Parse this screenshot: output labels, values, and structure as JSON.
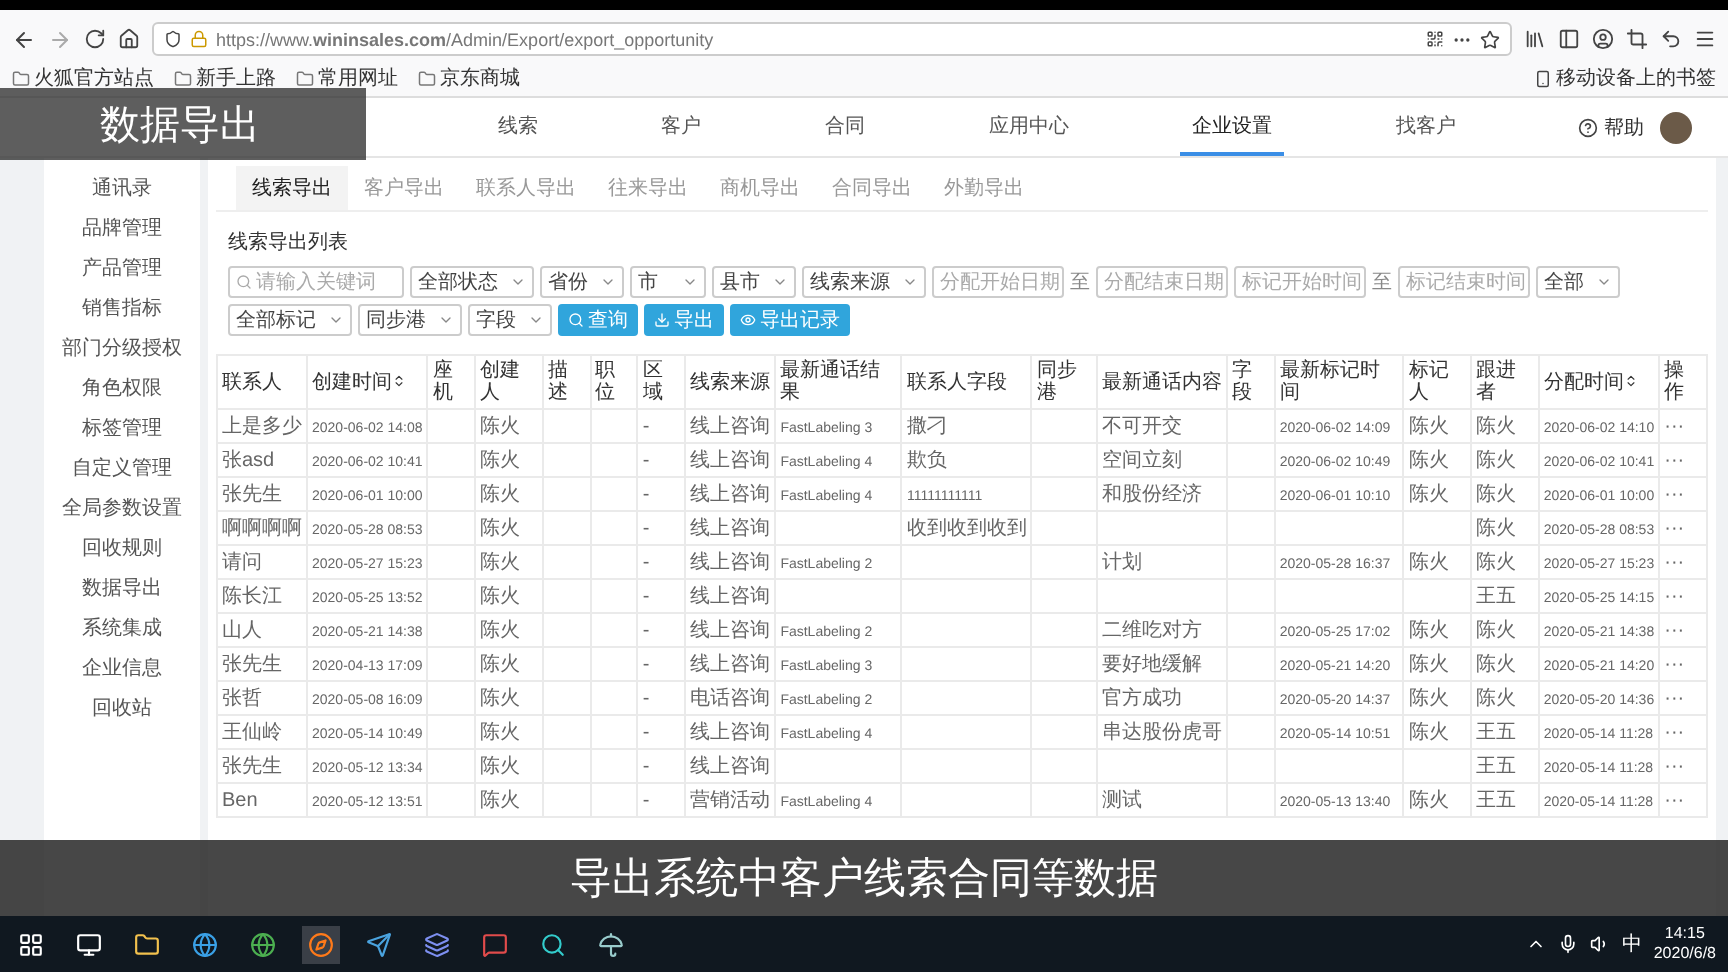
{
  "browser": {
    "url": "https://www.**wininsales.com**/Admin/Export/export_opportunity",
    "bookmarks": [
      "火狐官方站点",
      "新手上路",
      "常用网址",
      "京东商城"
    ],
    "mobile_bookmarks": "移动设备上的书签"
  },
  "caption": "数据导出",
  "nav": {
    "items": [
      {
        "label": "线索",
        "selected": false
      },
      {
        "label": "客户",
        "selected": false
      },
      {
        "label": "合同",
        "selected": false
      },
      {
        "label": "应用中心",
        "selected": false
      },
      {
        "label": "企业设置",
        "selected": true
      },
      {
        "label": "找客户",
        "selected": false
      }
    ],
    "help": "帮助"
  },
  "sidebar": {
    "items": [
      "通讯录",
      "品牌管理",
      "产品管理",
      "销售指标",
      "部门分级授权",
      "角色权限",
      "标签管理",
      "自定义管理",
      "全局参数设置",
      "回收规则",
      "数据导出",
      "系统集成",
      "企业信息",
      "回收站"
    ]
  },
  "tabs": [
    {
      "label": "线索导出",
      "selected": true
    },
    {
      "label": "客户导出",
      "selected": false
    },
    {
      "label": "联系人导出",
      "selected": false
    },
    {
      "label": "往来导出",
      "selected": false
    },
    {
      "label": "商机导出",
      "selected": false
    },
    {
      "label": "合同导出",
      "selected": false
    },
    {
      "label": "外勤导出",
      "selected": false
    }
  ],
  "list_title": "线索导出列表",
  "filters": [
    {
      "kind": "search",
      "placeholder": "请输入关键词"
    },
    {
      "kind": "select",
      "value": "全部状态"
    },
    {
      "kind": "select",
      "value": "省份"
    },
    {
      "kind": "select",
      "value": "市"
    },
    {
      "kind": "select",
      "value": "县市"
    },
    {
      "kind": "select",
      "value": "线索来源"
    },
    {
      "kind": "date",
      "placeholder": "分配开始日期"
    },
    {
      "kind": "sep",
      "text": "至"
    },
    {
      "kind": "date",
      "placeholder": "分配结束日期"
    },
    {
      "kind": "date",
      "placeholder": "标记开始时间"
    },
    {
      "kind": "sep",
      "text": "至"
    },
    {
      "kind": "date",
      "placeholder": "标记结束时间"
    },
    {
      "kind": "select",
      "value": "全部"
    },
    {
      "kind": "select",
      "value": "全部标记"
    },
    {
      "kind": "select",
      "value": "同步港"
    },
    {
      "kind": "select",
      "value": "字段"
    }
  ],
  "buttons": [
    {
      "kind": "search",
      "label": "查询"
    },
    {
      "kind": "export",
      "label": "导出"
    },
    {
      "kind": "history",
      "label": "导出记录"
    }
  ],
  "table": {
    "columns": [
      {
        "label": "联系人"
      },
      {
        "label": "创建时间",
        "sortable": true
      },
      {
        "label": "座机"
      },
      {
        "label": "创建人"
      },
      {
        "label": "描述"
      },
      {
        "label": "职位"
      },
      {
        "label": "区域"
      },
      {
        "label": "线索来源"
      },
      {
        "label": "最新通话结果"
      },
      {
        "label": "联系人字段"
      },
      {
        "label": "同步港"
      },
      {
        "label": "最新通话内容"
      },
      {
        "label": "字段"
      },
      {
        "label": "最新标记时间"
      },
      {
        "label": "标记人"
      },
      {
        "label": "跟进者"
      },
      {
        "label": "分配时间",
        "sortable": true
      },
      {
        "label": "操作"
      }
    ],
    "rows": [
      {
        "cells": [
          "上是多少",
          "2020-06-02 14:08",
          null,
          "陈火",
          null,
          null,
          "-",
          "线上咨询",
          "FastLabeling 3",
          "撒刁",
          null,
          "不可开交",
          null,
          "2020-06-02 14:09",
          "陈火",
          "陈火",
          "2020-06-02 14:10",
          "···"
        ]
      },
      {
        "cells": [
          "张asd",
          "2020-06-02 10:41",
          null,
          "陈火",
          null,
          null,
          "-",
          "线上咨询",
          "FastLabeling 4",
          "欺负",
          null,
          "空间立刻",
          null,
          "2020-06-02 10:49",
          "陈火",
          "陈火",
          "2020-06-02 10:41",
          "···"
        ]
      },
      {
        "cells": [
          "张先生",
          "2020-06-01 10:00",
          null,
          "陈火",
          null,
          null,
          "-",
          "线上咨询",
          "FastLabeling 4",
          "11111111111",
          null,
          "和股份经济",
          null,
          "2020-06-01 10:10",
          "陈火",
          "陈火",
          "2020-06-01 10:00",
          "···"
        ]
      },
      {
        "cells": [
          "啊啊啊啊",
          "2020-05-28 08:53",
          null,
          "陈火",
          null,
          null,
          "-",
          "线上咨询",
          null,
          "收到收到收到",
          null,
          null,
          null,
          null,
          null,
          "陈火",
          "2020-05-28 08:53",
          "···"
        ]
      },
      {
        "cells": [
          "请问",
          "2020-05-27 15:23",
          null,
          "陈火",
          null,
          null,
          "-",
          "线上咨询",
          "FastLabeling 2",
          null,
          null,
          "计划",
          null,
          "2020-05-28 16:37",
          "陈火",
          "陈火",
          "2020-05-27 15:23",
          "···"
        ]
      },
      {
        "cells": [
          "陈长江",
          "2020-05-25 13:52",
          null,
          "陈火",
          null,
          null,
          "-",
          "线上咨询",
          null,
          null,
          null,
          null,
          null,
          null,
          null,
          "王五",
          "2020-05-25 14:15",
          "···"
        ]
      },
      {
        "cells": [
          "山人",
          "2020-05-21 14:38",
          null,
          "陈火",
          null,
          null,
          "-",
          "线上咨询",
          "FastLabeling 2",
          null,
          null,
          "二维吃对方",
          null,
          "2020-05-25 17:02",
          "陈火",
          "陈火",
          "2020-05-21 14:38",
          "···"
        ]
      },
      {
        "cells": [
          "张先生",
          "2020-04-13 17:09",
          null,
          "陈火",
          null,
          null,
          "-",
          "线上咨询",
          "FastLabeling 3",
          null,
          null,
          "要好地缓解",
          null,
          "2020-05-21 14:20",
          "陈火",
          "陈火",
          "2020-05-21 14:20",
          "···"
        ]
      },
      {
        "cells": [
          "张哲",
          "2020-05-08 16:09",
          null,
          "陈火",
          null,
          null,
          "-",
          "电话咨询",
          "FastLabeling 2",
          null,
          null,
          "官方成功",
          null,
          "2020-05-20 14:37",
          "陈火",
          "陈火",
          "2020-05-20 14:36",
          "···"
        ]
      },
      {
        "cells": [
          "王仙岭",
          "2020-05-14 10:49",
          null,
          "陈火",
          null,
          null,
          "-",
          "线上咨询",
          "FastLabeling 4",
          null,
          null,
          "串达股份虎哥",
          null,
          "2020-05-14 10:51",
          "陈火",
          "王五",
          "2020-05-14 11:28",
          "···"
        ]
      },
      {
        "cells": [
          "张先生",
          "2020-05-12 13:34",
          null,
          "陈火",
          null,
          null,
          "-",
          "线上咨询",
          null,
          null,
          null,
          null,
          null,
          null,
          null,
          "王五",
          "2020-05-14 11:28",
          "···"
        ]
      },
      {
        "cells": [
          "Ben",
          "2020-05-12 13:51",
          null,
          "陈火",
          null,
          null,
          "-",
          "营销活动",
          "FastLabeling 4",
          null,
          null,
          "测试",
          null,
          "2020-05-13 13:40",
          "陈火",
          "王五",
          "2020-05-14 11:28",
          "···"
        ]
      }
    ]
  },
  "subtitle": "导出系统中客户线索合同等数据",
  "taskbar": {
    "ime": "中",
    "time": "14:15",
    "date": "2020/6/8"
  }
}
